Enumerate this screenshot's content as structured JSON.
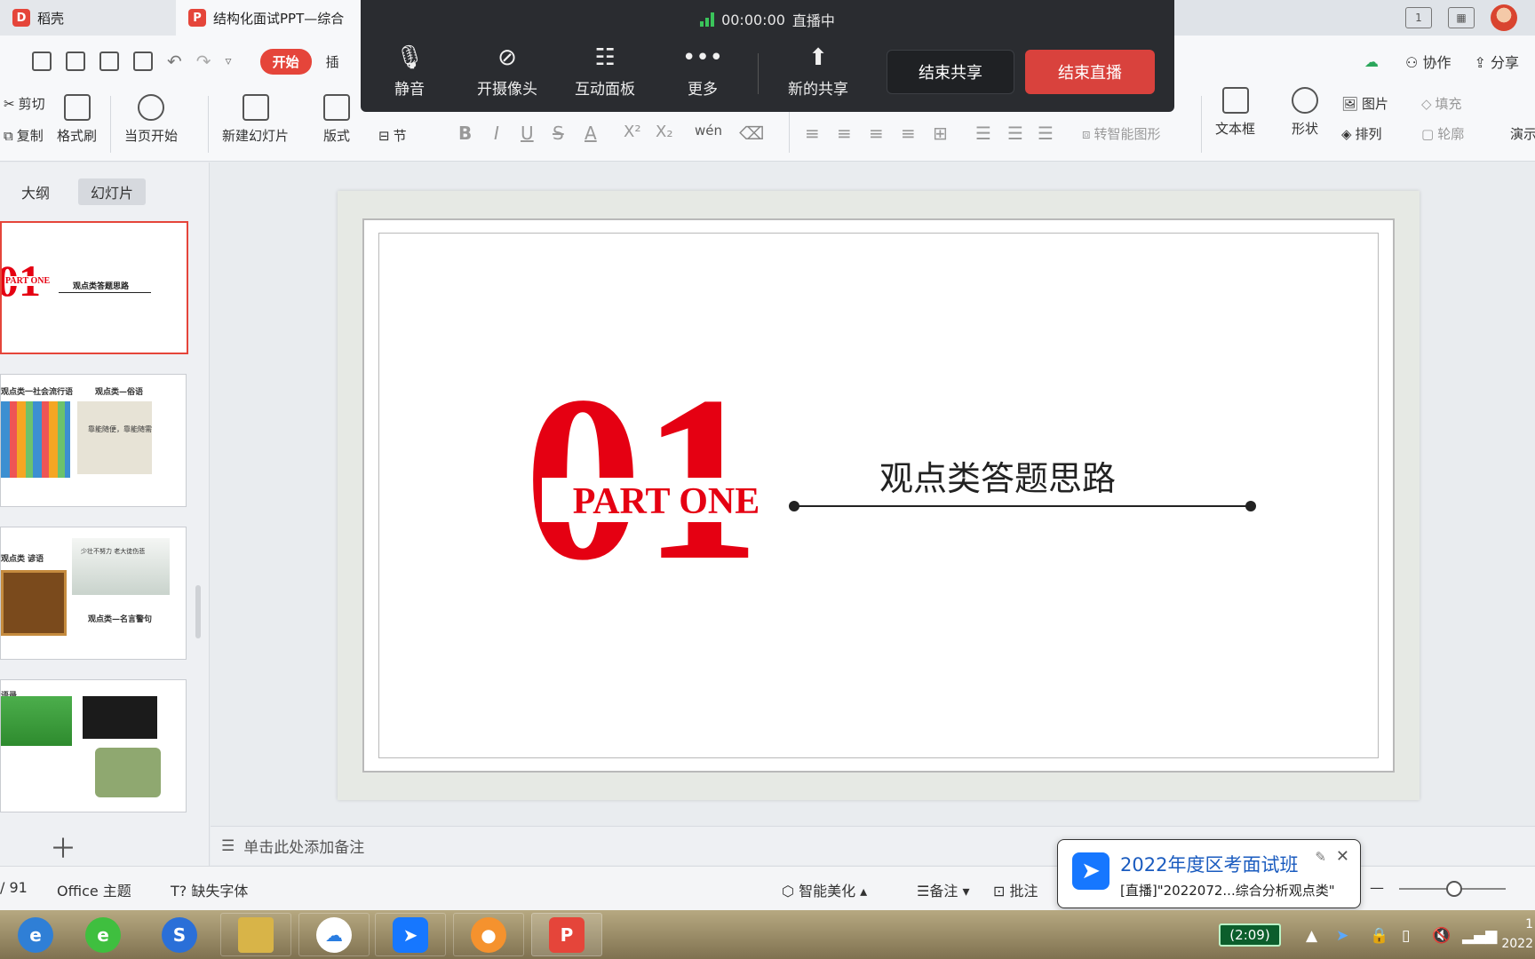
{
  "tabs": [
    {
      "label": "稻壳",
      "icon": "docer-icon"
    },
    {
      "label": "结构化面试PPT—综合",
      "icon": "ppt-icon"
    }
  ],
  "titlebar": {
    "page_view_label": "1"
  },
  "quickbar": {
    "start_label": "开始",
    "insert_label": "插",
    "cloud_label": "",
    "collab_label": "协作",
    "share_label": "分享"
  },
  "ribbon": {
    "cut": "剪切",
    "copy": "复制",
    "format_painter": "格式刷",
    "play_from_current": "当页开始",
    "new_slide": "新建幻灯片",
    "layout": "版式",
    "section": "节",
    "bold": "B",
    "italic": "I",
    "underline": "U",
    "strike": "S",
    "font_color": "A",
    "superscript": "X²",
    "subscript": "X₂",
    "phonetic": "wén",
    "smart_shape": "转智能图形",
    "textbox": "文本框",
    "shape": "形状",
    "picture": "图片",
    "fill": "填充",
    "arrange": "排列",
    "outline": "轮廓",
    "present": "演示"
  },
  "live": {
    "timer": "00:00:00",
    "status": "直播中",
    "mute": "静音",
    "camera": "开摄像头",
    "panel": "互动面板",
    "more": "更多",
    "new_share": "新的共享",
    "end_share": "结束共享",
    "end_live": "结束直播"
  },
  "leftpanel": {
    "tab_outline": "大纲",
    "tab_slides": "幻灯片",
    "thumbs": [
      {
        "title": "观点类答题思路",
        "number": "01",
        "part": "PART ONE"
      },
      {
        "title_left": "观点类一社会流行语",
        "title_right": "观点类—俗语",
        "sub": "靠能随便，靠能随需"
      },
      {
        "title_left": "观点类 谚语",
        "title_right": "观点类—名言警句",
        "sub": "少壮不努力 老大徒伤悲"
      },
      {
        "title_left": "语录",
        "sub": ""
      }
    ]
  },
  "slide": {
    "number": "01",
    "part_label": "PART ONE",
    "title": "观点类答题思路",
    "accent": "#e50012"
  },
  "notes": {
    "placeholder": "单击此处添加备注"
  },
  "statusbar": {
    "page": "/ 91",
    "theme": "Office 主题",
    "missing_font": "缺失字体",
    "beautify": "智能美化",
    "notes": "备注",
    "comments": "批注",
    "zoom_minus": "—"
  },
  "toast": {
    "title": "2022年度区考面试班",
    "subtitle": "[直播]\"2022072...综合分析观点类\""
  },
  "taskbar": {
    "battery": "(2:09)",
    "clock_time": "1",
    "clock_date": "2022"
  }
}
